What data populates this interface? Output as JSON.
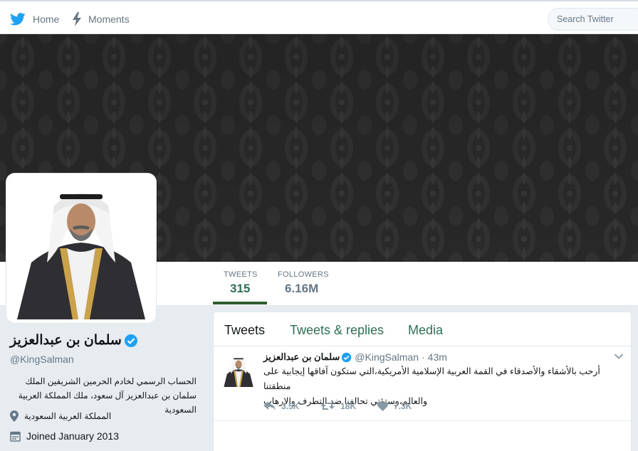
{
  "nav": {
    "home_label": "Home",
    "moments_label": "Moments",
    "search_placeholder": "Search Twitter"
  },
  "stats": {
    "tweets_label": "TWEETS",
    "tweets_value": "315",
    "followers_label": "FOLLOWERS",
    "followers_value": "6.16M"
  },
  "profile": {
    "name": "سلمان بن عبدالعزيز",
    "handle": "@KingSalman",
    "bio": "الحساب الرسمي لخادم الحرمين الشريفين الملك سلمان بن عبدالعزيز آل سعود، ملك المملكة العربية السعودية",
    "location": "المملكة العربية السعودية",
    "joined": "Joined January 2013",
    "verified": true
  },
  "timeline": {
    "tabs": [
      {
        "label": "Tweets"
      },
      {
        "label": "Tweets & replies"
      },
      {
        "label": "Media"
      }
    ],
    "tweet": {
      "name": "سلمان بن عبدالعزيز",
      "handle": "@KingSalman",
      "separator": "·",
      "time": "43m",
      "lines": [
        "أرحب بالأشقاء والأصدقاء في القمة العربية الإسلامية الأمريكية،التي ستكون آفاقها إيجابية على منطقتنا",
        "والعالم،وستؤتي تحالفنا ضد التطرف والإرهاب"
      ],
      "replies": "3.5K",
      "retweets": "18K",
      "likes": "7.3K"
    }
  },
  "colors": {
    "twitter_blue": "#1da1f2",
    "accent_green": "#2f6f54",
    "cover_dark": "#2b2b2b"
  }
}
